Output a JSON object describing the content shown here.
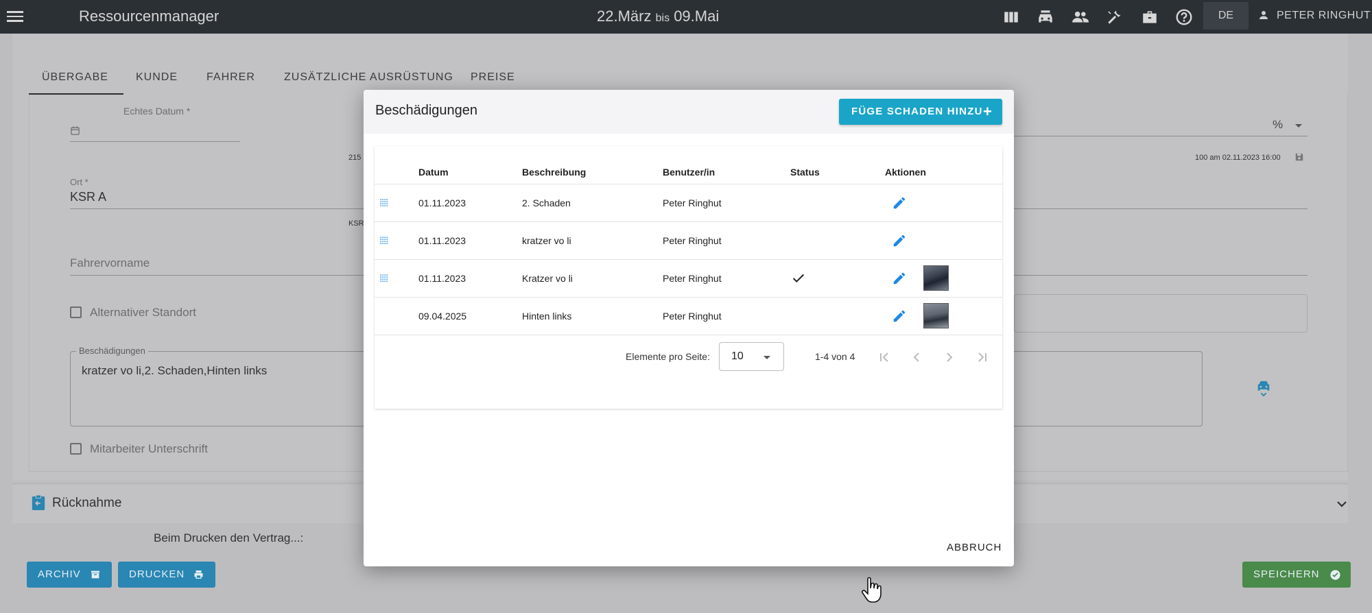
{
  "topbar": {
    "app_title": "Ressourcenmanager",
    "date_from": "22.März",
    "date_sep": "bis",
    "date_to": "09.Mai",
    "icons": [
      "columns-icon",
      "car-icon",
      "people-icon",
      "tools-icon",
      "briefcase-icon",
      "help-icon"
    ],
    "language": "DE",
    "user": "PETER RINGHUT"
  },
  "form": {
    "tabs": [
      "ÜBERGABE",
      "KUNDE",
      "FAHRER",
      "ZUSÄTZLICHE AUSRÜSTUNG",
      "PREISE"
    ],
    "real_date_label": "Echtes Datum *",
    "percent_value": "%",
    "hint_mileage": "215",
    "hint_saved": "100 am 02.11.2023 16:00",
    "location_label": "Ort *",
    "location_value": "KSR A",
    "location_hint": "KSR",
    "driver_first_name_placeholder": "Fahrervorname",
    "alt_location_label": "Alternativer Standort",
    "damages_label": "Beschädigungen",
    "damages_value": "kratzer vo li,2. Schaden,Hinten links",
    "employee_signature_label": "Mitarbeiter Unterschrift",
    "return_section_title": "Rücknahme",
    "print_note": "Beim Drucken den Vertrag...:",
    "archive_button": "ARCHIV",
    "print_button": "DRUCKEN",
    "save_button": "SPEICHERN"
  },
  "dialog": {
    "title": "Beschädigungen",
    "add_button": "FÜGE SCHADEN HINZU",
    "columns": [
      "Datum",
      "Beschreibung",
      "Benutzer/in",
      "Status",
      "Aktionen"
    ],
    "rows": [
      {
        "date": "01.11.2023",
        "description": "2. Schaden",
        "user": "Peter Ringhut",
        "status_done": false,
        "has_image": false,
        "draggable": true
      },
      {
        "date": "01.11.2023",
        "description": "kratzer vo li",
        "user": "Peter Ringhut",
        "status_done": false,
        "has_image": false,
        "draggable": true
      },
      {
        "date": "01.11.2023",
        "description": "Kratzer vo li",
        "user": "Peter Ringhut",
        "status_done": true,
        "has_image": true,
        "draggable": true
      },
      {
        "date": "09.04.2025",
        "description": "Hinten links",
        "user": "Peter Ringhut",
        "status_done": false,
        "has_image": true,
        "draggable": false
      }
    ],
    "pagination": {
      "items_per_page_label": "Elemente pro Seite:",
      "items_per_page": "10",
      "range": "1-4 von 4"
    },
    "cancel_button": "ABBRUCH"
  },
  "colors": {
    "topbar": "#2b3035",
    "accent": "#1aa5c8",
    "edit_icon": "#1e88e5",
    "save_green": "#4a8a4a",
    "button_blue": "#2a86b3"
  }
}
